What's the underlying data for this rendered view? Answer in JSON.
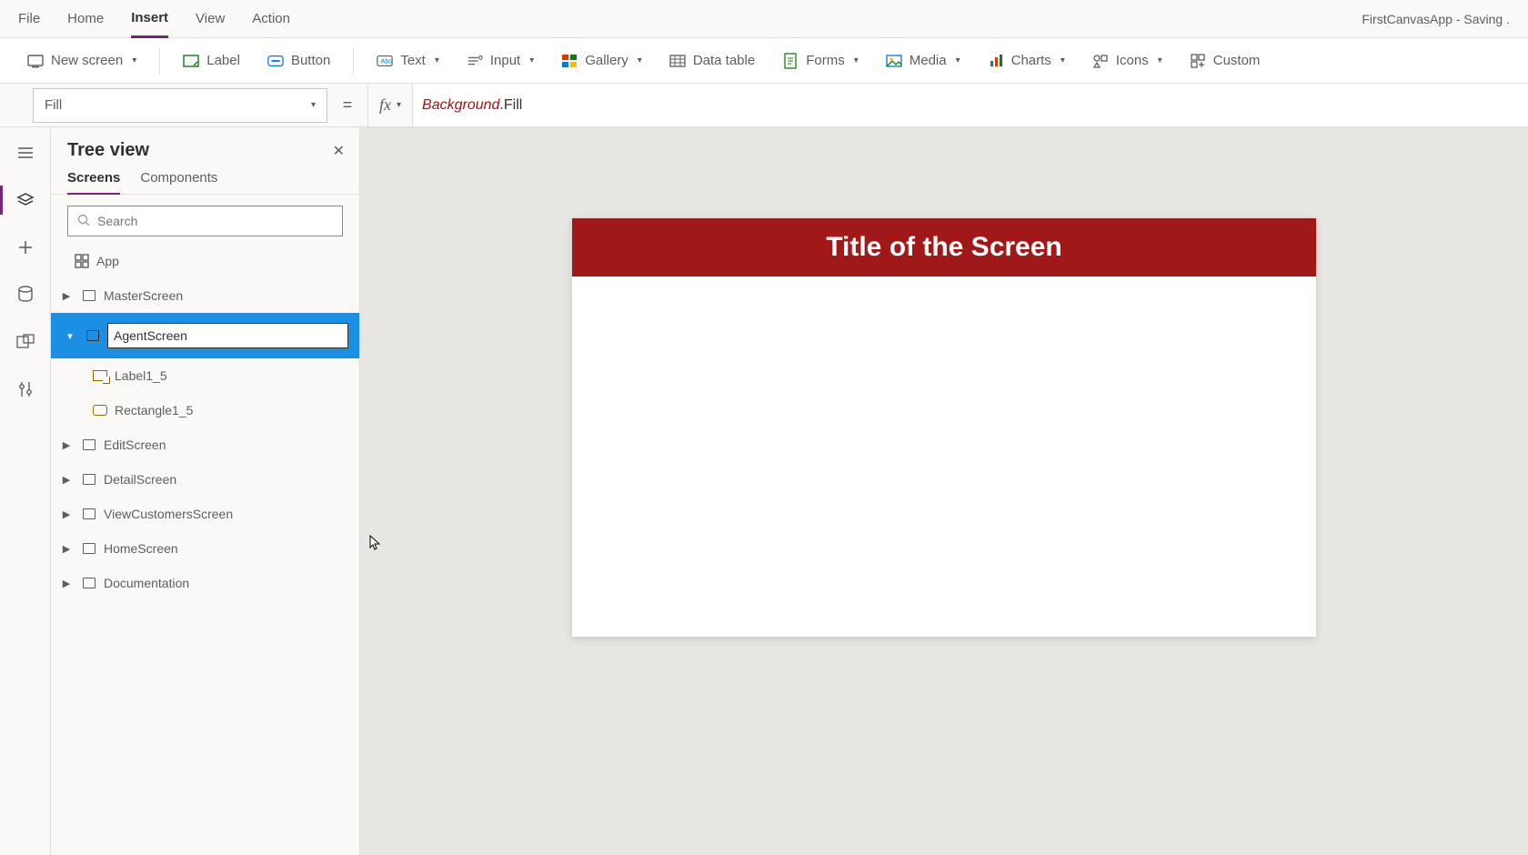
{
  "menubar": {
    "items": [
      "File",
      "Home",
      "Insert",
      "View",
      "Action"
    ],
    "active_index": 2,
    "app_title": "FirstCanvasApp - Saving ."
  },
  "ribbon": {
    "new_screen": "New screen",
    "label": "Label",
    "button": "Button",
    "text": "Text",
    "input": "Input",
    "gallery": "Gallery",
    "data_table": "Data table",
    "forms": "Forms",
    "media": "Media",
    "charts": "Charts",
    "icons": "Icons",
    "custom": "Custom"
  },
  "property_row": {
    "property": "Fill",
    "fx": "fx",
    "formula_obj": "Background",
    "formula_prop": ".Fill"
  },
  "tree": {
    "title": "Tree view",
    "tabs": [
      "Screens",
      "Components"
    ],
    "active_tab": 0,
    "search_placeholder": "Search",
    "app_node": "App",
    "nodes": [
      {
        "label": "MasterScreen",
        "expanded": false
      },
      {
        "label": "AgentScreen",
        "expanded": true,
        "editing": true,
        "children": [
          {
            "label": "Label1_5",
            "type": "label"
          },
          {
            "label": "Rectangle1_5",
            "type": "rect"
          }
        ]
      },
      {
        "label": "EditScreen",
        "expanded": false
      },
      {
        "label": "DetailScreen",
        "expanded": false
      },
      {
        "label": "ViewCustomersScreen",
        "expanded": false
      },
      {
        "label": "HomeScreen",
        "expanded": false
      },
      {
        "label": "Documentation",
        "expanded": false
      }
    ]
  },
  "canvas": {
    "title": "Title of the Screen",
    "header_color": "#a01818"
  }
}
